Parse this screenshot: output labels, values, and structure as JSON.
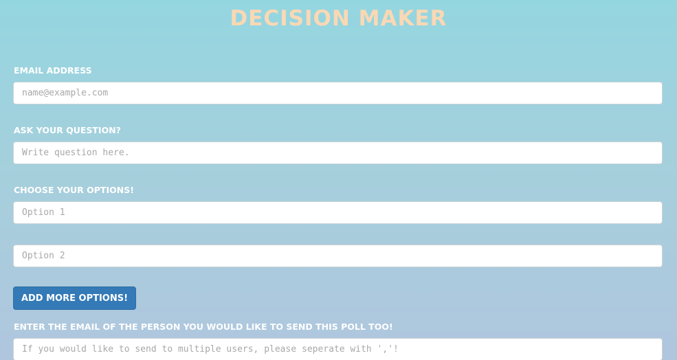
{
  "page": {
    "title": "Decision Maker"
  },
  "form": {
    "email": {
      "label": "Email Address",
      "placeholder": "name@example.com",
      "value": ""
    },
    "question": {
      "label": "Ask your question?",
      "placeholder": "Write question here.",
      "value": ""
    },
    "options": {
      "label": "Choose your options!",
      "items": [
        {
          "placeholder": "Option 1",
          "value": ""
        },
        {
          "placeholder": "Option 2",
          "value": ""
        }
      ],
      "add_button_label": "Add more options!"
    },
    "recipients": {
      "label": "Enter the email of the person you would like to send this poll too!",
      "placeholder": "If you would like to send to multiple users, please seperate with ','!",
      "value": ""
    }
  },
  "colors": {
    "title": "#fad8b4",
    "label": "#ffffff",
    "button_bg": "#337ab7",
    "background_top": "#94d6e0",
    "background_bottom": "#b0c6de"
  }
}
